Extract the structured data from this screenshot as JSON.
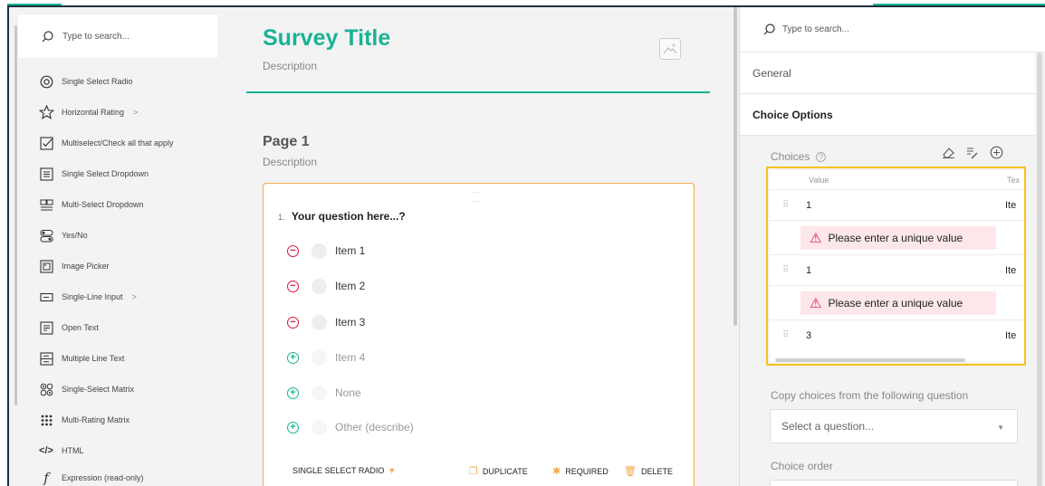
{
  "toolbox": {
    "search_placeholder": "Type to search...",
    "items": [
      {
        "label": "Single Select Radio",
        "icon": "radio-icon"
      },
      {
        "label": "Horizontal Rating",
        "icon": "star-icon",
        "submenu": true
      },
      {
        "label": "Multiselect/Check all that apply",
        "icon": "checkbox-icon"
      },
      {
        "label": "Single Select Dropdown",
        "icon": "dropdown-icon"
      },
      {
        "label": "Multi-Select Dropdown",
        "icon": "tagbox-icon"
      },
      {
        "label": "Yes/No",
        "icon": "toggle-icon"
      },
      {
        "label": "Image Picker",
        "icon": "image-picker-icon"
      },
      {
        "label": "Single-Line Input",
        "icon": "text-input-icon",
        "submenu": true
      },
      {
        "label": "Open Text",
        "icon": "comment-icon"
      },
      {
        "label": "Multiple Line Text",
        "icon": "multiple-text-icon"
      },
      {
        "label": "Single-Select Matrix",
        "icon": "matrix-icon"
      },
      {
        "label": "Multi-Rating Matrix",
        "icon": "matrix-dropdown-icon"
      },
      {
        "label": "HTML",
        "icon": "html-icon"
      },
      {
        "label": "Expression (read-only)",
        "icon": "expression-icon"
      }
    ]
  },
  "survey": {
    "title": "Survey Title",
    "description": "Description",
    "page": {
      "title": "Page 1",
      "description": "Description"
    },
    "question": {
      "number": "1.",
      "title": "Your question here...?",
      "choices": [
        "Item 1",
        "Item 2",
        "Item 3"
      ],
      "ghost_choices": [
        "Item 4",
        "None",
        "Other (describe)"
      ],
      "type_label": "SINGLE SELECT RADIO",
      "actions": {
        "duplicate": "DUPLICATE",
        "required": "REQUIRED",
        "delete": "DELETE"
      }
    }
  },
  "properties": {
    "search_placeholder": "Type to search...",
    "categories": {
      "general": "General",
      "choice_options": "Choice Options"
    },
    "choices": {
      "label": "Choices",
      "columns": {
        "value": "Value",
        "text": "Tex"
      },
      "rows": [
        {
          "value": "1",
          "text": "Ite",
          "error": "Please enter a unique value"
        },
        {
          "value": "1",
          "text": "Ite",
          "error": "Please enter a unique value"
        },
        {
          "value": "3",
          "text": "Ite"
        }
      ]
    },
    "copy_label": "Copy choices from the following question",
    "copy_placeholder": "Select a question...",
    "order_label": "Choice order"
  },
  "colors": {
    "accent": "#19b394",
    "warning": "#f5a94a",
    "error": "#e0143c",
    "highlight": "#f7c21b"
  }
}
